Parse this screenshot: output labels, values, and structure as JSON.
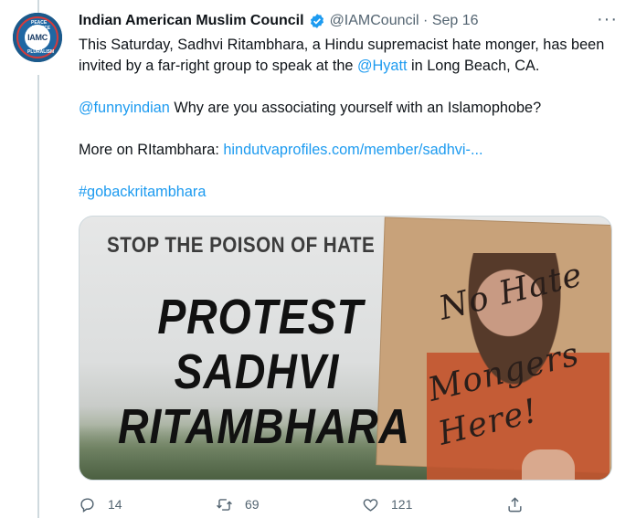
{
  "tweet": {
    "avatar_text": "IAMC",
    "avatar_ring_top": "PEACE JUSTICE",
    "avatar_ring_bottom": "PLURALISM",
    "author_name": "Indian American Muslim Council",
    "handle_date": "@IAMCouncil · Sep 16",
    "more": "···",
    "line1_pre": "This Saturday, Sadhvi Ritambhara, a Hindu supremacist hate monger, has been invited by a far-right group to speak at the ",
    "line1_mention": "@Hyatt",
    "line1_post": "  in Long Beach, CA.",
    "line2_mention": "@funnyindian",
    "line2_post": " Why are you associating yourself with an Islamophobe?",
    "line3_pre": "More on RItambhara: ",
    "line3_link": "hindutvaprofiles.com/member/sadhvi-...",
    "line4_hashtag": "#gobackritambhara"
  },
  "media": {
    "stop_text": "STOP THE POISON OF HATE",
    "protest_line1": "PROTEST",
    "protest_line2": "SADHVI",
    "protest_line3": "RITAMBHARA",
    "sign_line1": "No Hate",
    "sign_line2": "Hate",
    "sign_line3": "Mongers",
    "sign_line4": "Here!"
  },
  "actions": {
    "reply_count": "14",
    "retweet_count": "69",
    "like_count": "121"
  },
  "colors": {
    "link": "#1d9bf0",
    "secondary": "#536471",
    "verified": "#1d9bf0"
  }
}
